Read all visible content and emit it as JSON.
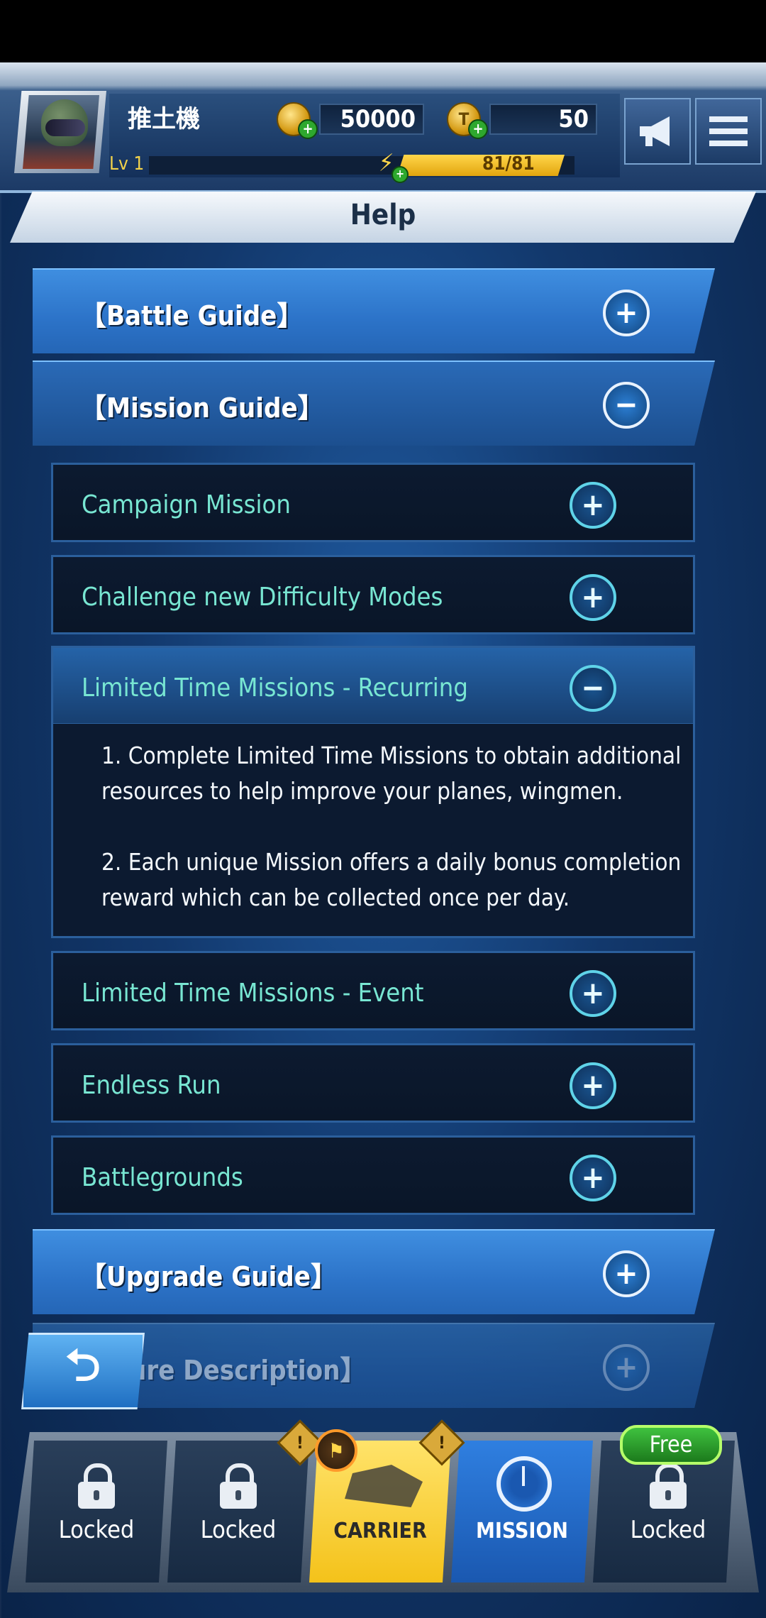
{
  "header": {
    "player_name": "推土機",
    "level_label": "Lv",
    "level": "1",
    "gold": "50000",
    "tokens": "50",
    "token_symbol": "T",
    "energy": "81/81"
  },
  "page": {
    "title": "Help"
  },
  "sections": [
    {
      "label": "【Battle Guide】",
      "toggle": "+"
    },
    {
      "label": "【Mission Guide】",
      "toggle": "−"
    },
    {
      "label": "【Upgrade Guide】",
      "toggle": "+"
    },
    {
      "label": "ure Description】",
      "toggle": "+"
    }
  ],
  "mission_items": [
    {
      "label": "Campaign Mission",
      "toggle": "+"
    },
    {
      "label": "Challenge new Difficulty Modes",
      "toggle": "+"
    },
    {
      "label": "Limited Time Missions - Recurring",
      "toggle": "−"
    },
    {
      "label": "Limited Time Missions - Event",
      "toggle": "+"
    },
    {
      "label": "Endless Run",
      "toggle": "+"
    },
    {
      "label": "Battlegrounds",
      "toggle": "+"
    }
  ],
  "expanded_content": {
    "p1": "1. Complete Limited Time Missions to obtain additional resources to help improve your planes, wingmen.",
    "p2": "2. Each unique Mission offers a daily bonus completion reward which can be collected once per day."
  },
  "back_button": {
    "symbol": "⮌"
  },
  "nav": {
    "tabs": [
      {
        "label": "Locked"
      },
      {
        "label": "Locked"
      },
      {
        "label": "CARRIER"
      },
      {
        "label": "MISSION"
      },
      {
        "label": "Locked"
      }
    ],
    "free_badge": "Free",
    "warn_symbol": "!"
  }
}
